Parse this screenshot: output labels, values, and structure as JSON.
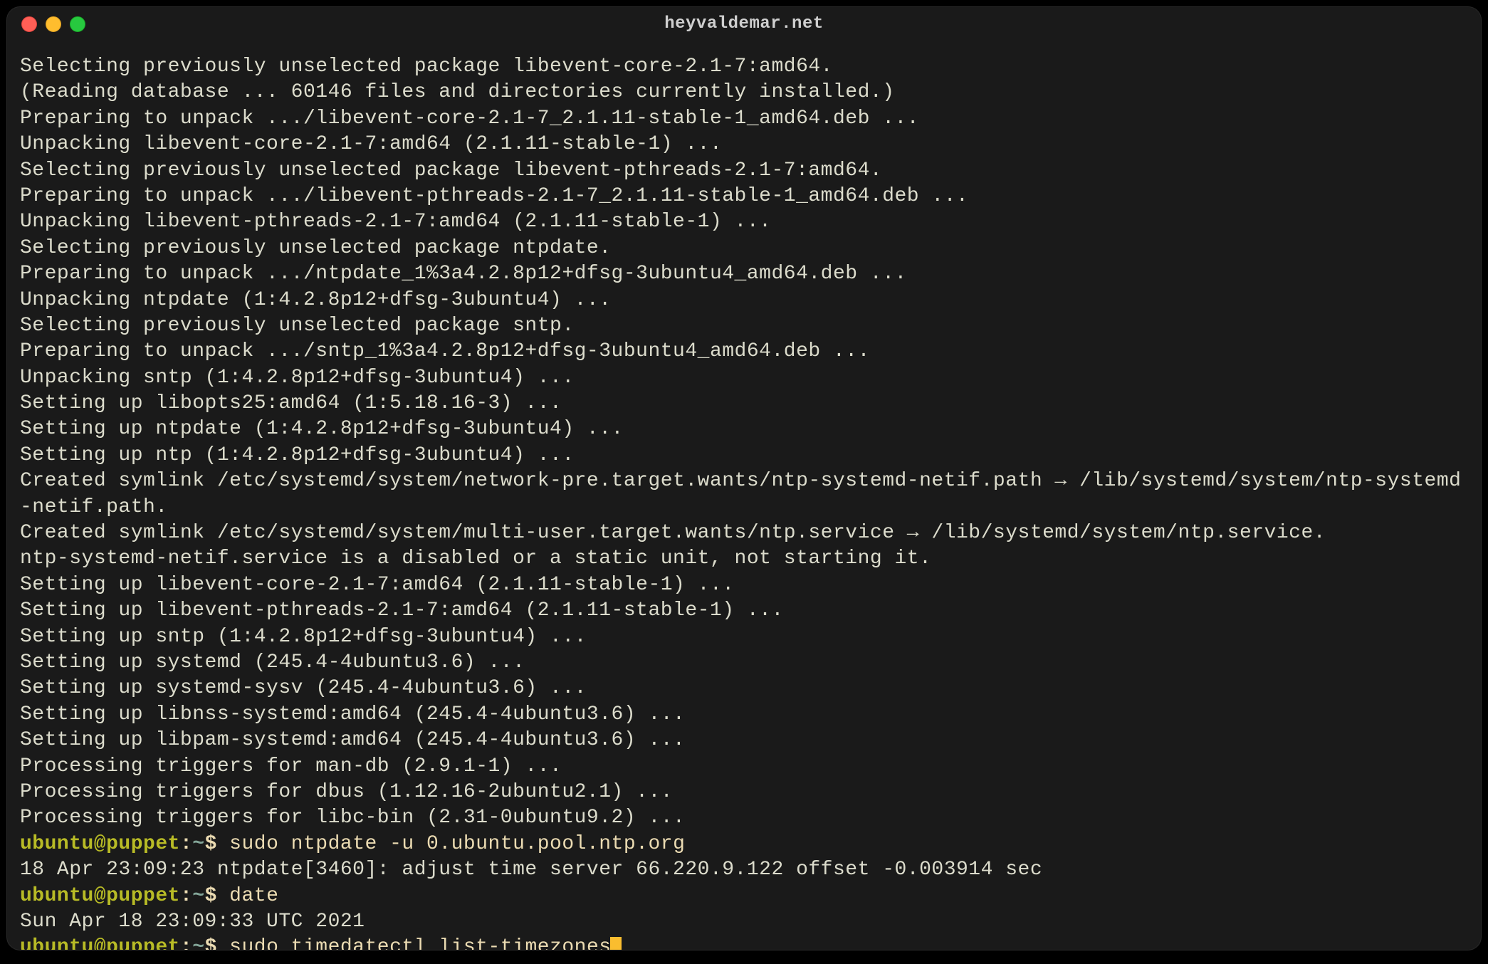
{
  "window": {
    "title": "heyvaldemar.net"
  },
  "terminal": {
    "output": [
      "Selecting previously unselected package libevent-core-2.1-7:amd64.",
      "(Reading database ... 60146 files and directories currently installed.)",
      "Preparing to unpack .../libevent-core-2.1-7_2.1.11-stable-1_amd64.deb ...",
      "Unpacking libevent-core-2.1-7:amd64 (2.1.11-stable-1) ...",
      "Selecting previously unselected package libevent-pthreads-2.1-7:amd64.",
      "Preparing to unpack .../libevent-pthreads-2.1-7_2.1.11-stable-1_amd64.deb ...",
      "Unpacking libevent-pthreads-2.1-7:amd64 (2.1.11-stable-1) ...",
      "Selecting previously unselected package ntpdate.",
      "Preparing to unpack .../ntpdate_1%3a4.2.8p12+dfsg-3ubuntu4_amd64.deb ...",
      "Unpacking ntpdate (1:4.2.8p12+dfsg-3ubuntu4) ...",
      "Selecting previously unselected package sntp.",
      "Preparing to unpack .../sntp_1%3a4.2.8p12+dfsg-3ubuntu4_amd64.deb ...",
      "Unpacking sntp (1:4.2.8p12+dfsg-3ubuntu4) ...",
      "Setting up libopts25:amd64 (1:5.18.16-3) ...",
      "Setting up ntpdate (1:4.2.8p12+dfsg-3ubuntu4) ...",
      "Setting up ntp (1:4.2.8p12+dfsg-3ubuntu4) ...",
      "Created symlink /etc/systemd/system/network-pre.target.wants/ntp-systemd-netif.path → /lib/systemd/system/ntp-systemd-netif.path.",
      "Created symlink /etc/systemd/system/multi-user.target.wants/ntp.service → /lib/systemd/system/ntp.service.",
      "ntp-systemd-netif.service is a disabled or a static unit, not starting it.",
      "Setting up libevent-core-2.1-7:amd64 (2.1.11-stable-1) ...",
      "Setting up libevent-pthreads-2.1-7:amd64 (2.1.11-stable-1) ...",
      "Setting up sntp (1:4.2.8p12+dfsg-3ubuntu4) ...",
      "Setting up systemd (245.4-4ubuntu3.6) ...",
      "Setting up systemd-sysv (245.4-4ubuntu3.6) ...",
      "Setting up libnss-systemd:amd64 (245.4-4ubuntu3.6) ...",
      "Setting up libpam-systemd:amd64 (245.4-4ubuntu3.6) ...",
      "Processing triggers for man-db (2.9.1-1) ...",
      "Processing triggers for dbus (1.12.16-2ubuntu2.1) ...",
      "Processing triggers for libc-bin (2.31-0ubuntu9.2) ..."
    ],
    "prompts": [
      {
        "user": "ubuntu@puppet",
        "path": "~",
        "command": "sudo ntpdate -u 0.ubuntu.pool.ntp.org",
        "output": [
          "18 Apr 23:09:23 ntpdate[3460]: adjust time server 66.220.9.122 offset -0.003914 sec"
        ]
      },
      {
        "user": "ubuntu@puppet",
        "path": "~",
        "command": "date",
        "output": [
          "Sun Apr 18 23:09:33 UTC 2021"
        ]
      },
      {
        "user": "ubuntu@puppet",
        "path": "~",
        "command": "sudo timedatectl list-timezones",
        "output": [],
        "cursor": true
      }
    ]
  }
}
